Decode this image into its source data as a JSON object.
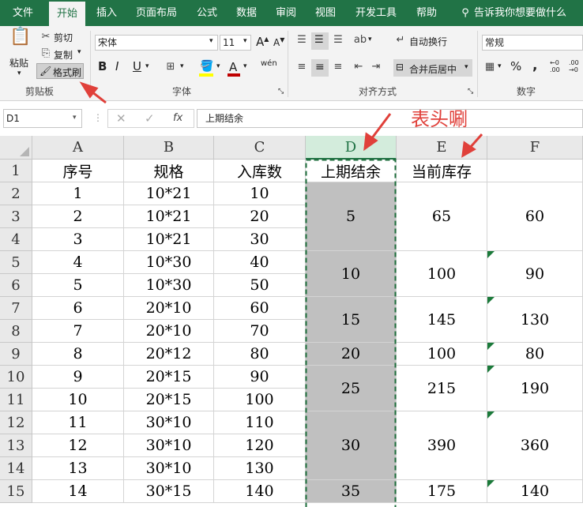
{
  "tabs": [
    "文件",
    "开始",
    "插入",
    "页面布局",
    "公式",
    "数据",
    "审阅",
    "视图",
    "开发工具",
    "帮助"
  ],
  "search_hint": "告诉我你想要做什么",
  "clipboard": {
    "paste": "粘贴",
    "cut": "剪切",
    "copy": "复制",
    "format_painter": "格式刷",
    "group": "剪贴板"
  },
  "font": {
    "name": "宋体",
    "size": "11",
    "bold": "B",
    "italic": "I",
    "underline": "U",
    "font_color_glyph": "A",
    "phonetic": "wén",
    "group": "字体"
  },
  "alignment": {
    "wrap": "自动换行",
    "merge": "合并后居中",
    "group": "对齐方式"
  },
  "number": {
    "format": "常规",
    "group": "数字",
    "percent": "%",
    "comma": ","
  },
  "formula_bar": {
    "name_box": "D1",
    "fx": "fx",
    "content": "上期结余"
  },
  "annotation": "表头唰",
  "colors": {
    "accent": "#217346",
    "annotation": "#e0403a",
    "merged_fill": "#c0c0c0"
  },
  "columns": [
    "A",
    "B",
    "C",
    "D",
    "E",
    "F"
  ],
  "rows": [
    "1",
    "2",
    "3",
    "4",
    "5",
    "6",
    "7",
    "8",
    "9",
    "10",
    "11",
    "12",
    "13",
    "14",
    "15"
  ],
  "headers": {
    "a": "序号",
    "b": "规格",
    "c": "入库数",
    "d": "上期结余",
    "e": "当前库存"
  },
  "data_a": [
    "1",
    "2",
    "3",
    "4",
    "5",
    "6",
    "7",
    "8",
    "9",
    "10",
    "11",
    "12",
    "13",
    "14"
  ],
  "data_b": [
    "10*21",
    "10*21",
    "10*21",
    "10*30",
    "10*30",
    "20*10",
    "20*10",
    "20*12",
    "20*15",
    "20*15",
    "30*10",
    "30*10",
    "30*10",
    "30*15"
  ],
  "data_c": [
    "10",
    "20",
    "30",
    "40",
    "50",
    "60",
    "70",
    "80",
    "90",
    "100",
    "110",
    "120",
    "130",
    "140"
  ],
  "merged": [
    {
      "d": "5",
      "e": "65",
      "f": "60"
    },
    {
      "d": "10",
      "e": "100",
      "f": "90"
    },
    {
      "d": "15",
      "e": "145",
      "f": "130"
    },
    {
      "d": "20",
      "e": "100",
      "f": "80"
    },
    {
      "d": "25",
      "e": "215",
      "f": "190"
    },
    {
      "d": "30",
      "e": "390",
      "f": "360"
    },
    {
      "d": "35",
      "e": "175",
      "f": "140"
    }
  ]
}
